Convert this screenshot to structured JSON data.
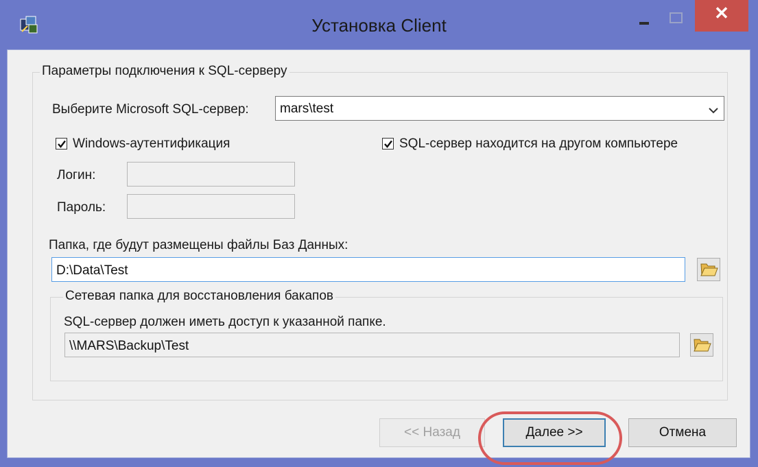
{
  "window": {
    "title": "Установка Client",
    "icon": "setup-app-icon",
    "close_glyph": "✕"
  },
  "main_group": {
    "legend": "Параметры подключения к SQL-серверу",
    "server_label": "Выберите Microsoft SQL-сервер:",
    "server_value": "mars\\test",
    "windows_auth": {
      "label": "Windows-аутентификация",
      "checked": true
    },
    "remote_server": {
      "label": "SQL-сервер находится на другом компьютере",
      "checked": true
    },
    "login_label": "Логин:",
    "login_value": "",
    "password_label": "Пароль:",
    "password_value": "",
    "db_folder_label": "Папка, где будут размещены файлы Баз Данных:",
    "db_folder_value": "D:\\Data\\Test"
  },
  "backup_group": {
    "legend": "Сетевая папка для восстановления бакапов",
    "note": "SQL-сервер должен иметь доступ к указанной папке.",
    "path_value": "\\\\MARS\\Backup\\Test"
  },
  "buttons": {
    "back": "<< Назад",
    "next": "Далее >>",
    "cancel": "Отмена"
  },
  "colors": {
    "frame": "#6b79c9",
    "close": "#c7504b",
    "highlight": "#d95a5a"
  }
}
